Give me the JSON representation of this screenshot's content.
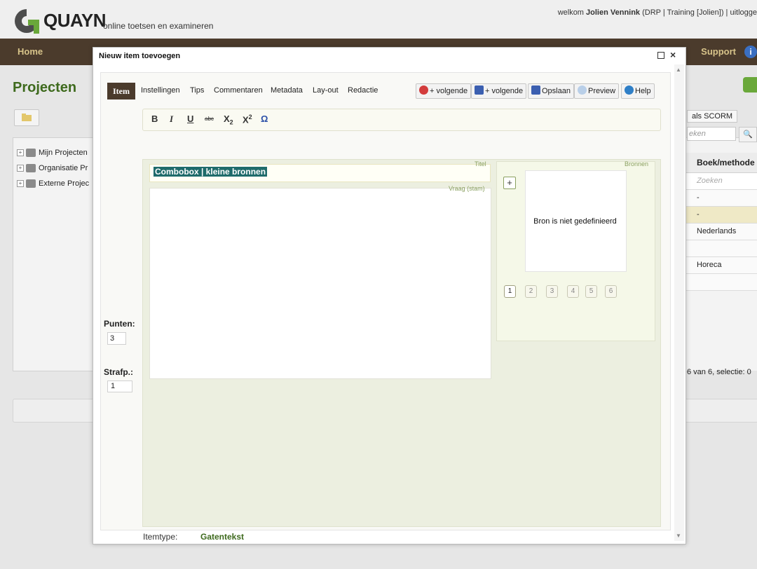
{
  "app": {
    "logo_text": "QUAYN",
    "tagline": "online toetsen en examineren",
    "welcome_prefix": "welkom ",
    "user_name": "Jolien Vennink",
    "user_context": " (DRP | Training [Jolien])  |  uitlogge"
  },
  "nav": {
    "home": "Home",
    "support": "Support",
    "info_glyph": "i"
  },
  "background_page": {
    "title": "Projecten",
    "tree": [
      "Mijn Projecten",
      "Organisatie Pr",
      "Externe Projec"
    ],
    "scorm_button": "als SCORM",
    "search_placeholder": "eken",
    "column_header": "Boek/methode",
    "filter_placeholder": "Zoeken",
    "rows": [
      "-",
      "-",
      "Nederlands",
      "",
      "Horeca",
      ""
    ],
    "paging": "6 van 6,  selectie: 0"
  },
  "modal": {
    "title": "Nieuw item toevoegen",
    "tabs": [
      "Item",
      "Instellingen",
      "Tips",
      "Commentaren",
      "Metadata",
      "Lay-out",
      "Redactie"
    ],
    "actions": {
      "cancel_next": "+ volgende",
      "save_next": "+ volgende",
      "save": "Opslaan",
      "preview": "Preview",
      "help": "Help"
    },
    "format_toolbar": {
      "bold": "B",
      "italic": "I",
      "underline": "U",
      "strike": "abc",
      "subscript": "X",
      "subscript_index": "2",
      "superscript": "X",
      "superscript_index": "2",
      "omega": "Ω"
    },
    "title_label": "Titel",
    "title_value": "Combobox | kleine bronnen",
    "stem_label": "Vraag (stam)",
    "sources": {
      "label": "Bronnen",
      "add": "+",
      "empty_text": "Bron is niet gedefinieerd",
      "pages": [
        "1",
        "2",
        "3",
        "4",
        "5",
        "6"
      ]
    },
    "points_label": "Punten:",
    "points_value": "3",
    "penalty_label": "Strafp.:",
    "penalty_value": "1",
    "itemtype_label": "Itemtype:",
    "itemtype_value": "Gatentekst"
  },
  "colors": {
    "nav_brown": "#4b3b2c",
    "brand_green": "#3e6a1d",
    "selection_teal": "#1f6b6b",
    "panel_green": "#ecefe0"
  }
}
